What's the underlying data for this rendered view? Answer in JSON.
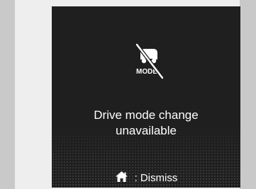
{
  "dialog": {
    "icon": "drive-mode-disabled-icon",
    "icon_text": "MODE",
    "message_line1": "Drive mode change",
    "message_line2": "unavailable"
  },
  "footer": {
    "home_icon": "home-icon",
    "separator": ":",
    "action_label": "Dismiss"
  },
  "colors": {
    "screen_bg": "#1f1f1f",
    "text": "#ffffff",
    "outer_bg": "#eeeeee"
  }
}
